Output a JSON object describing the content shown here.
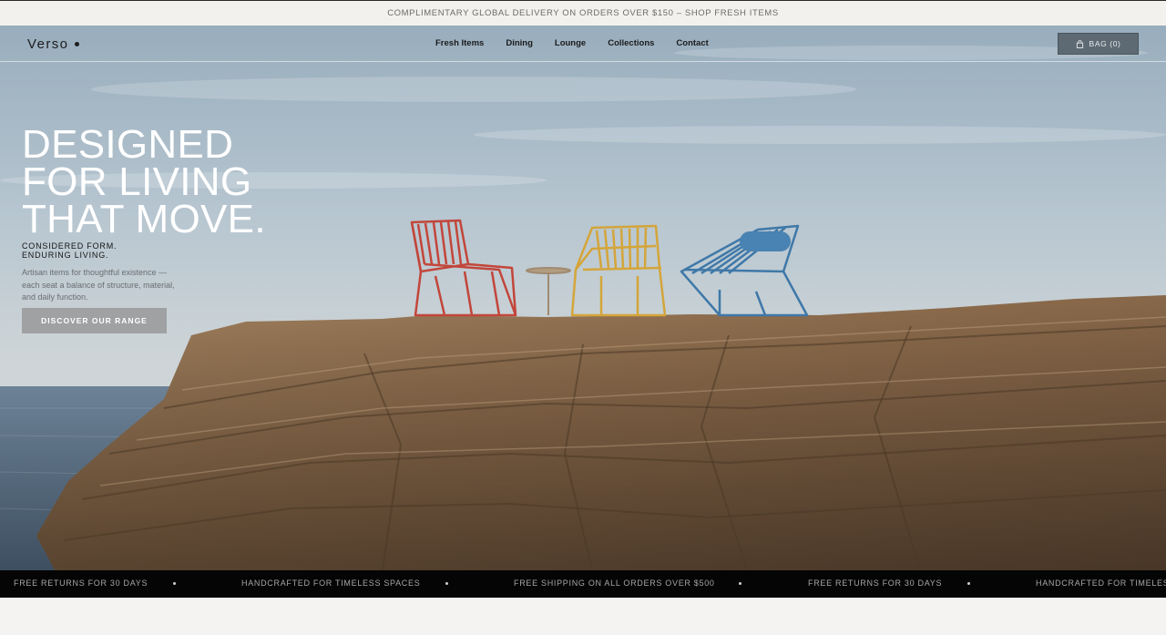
{
  "announcement": {
    "text": "COMPLIMENTARY GLOBAL DELIVERY ON ORDERS OVER $150 – SHOP FRESH ITEMS"
  },
  "nav": {
    "logo": "Verso",
    "items": [
      {
        "label": "Fresh Items"
      },
      {
        "label": "Dining"
      },
      {
        "label": "Lounge"
      },
      {
        "label": "Collections"
      },
      {
        "label": "Contact"
      }
    ],
    "bag_label": "BAG (0)"
  },
  "hero": {
    "headline_lines": [
      "DESIGNED",
      "FOR LIVING",
      "THAT MOVE."
    ],
    "subheading_lines": [
      "CONSIDERED FORM.",
      "ENDURING LIVING."
    ],
    "description": "Artisan items for thoughtful existence — each seat a balance of structure, material, and daily function.",
    "cta_label": "DISCOVER OUR RANGE",
    "image_description": "Three wire lounge chairs (red, yellow, blue) with a small side table on a layered rock outcrop above the sea",
    "chair_colors": [
      "#c2463b",
      "#d4a53a",
      "#3f78a8"
    ]
  },
  "ticker": {
    "items": [
      "FREE RETURNS FOR 30 DAYS",
      "HANDCRAFTED FOR TIMELESS SPACES",
      "FREE SHIPPING ON ALL ORDERS OVER $500",
      "FREE RETURNS FOR 30 DAYS",
      "HANDCRAFTED FOR TIMELESS SPACES"
    ]
  },
  "colors": {
    "ticker_bg": "#050505",
    "bag_bg": "#5e6a73",
    "sky": "#b6c5cf",
    "rock": "#8a6b4e",
    "sea": "#5c6f80"
  }
}
